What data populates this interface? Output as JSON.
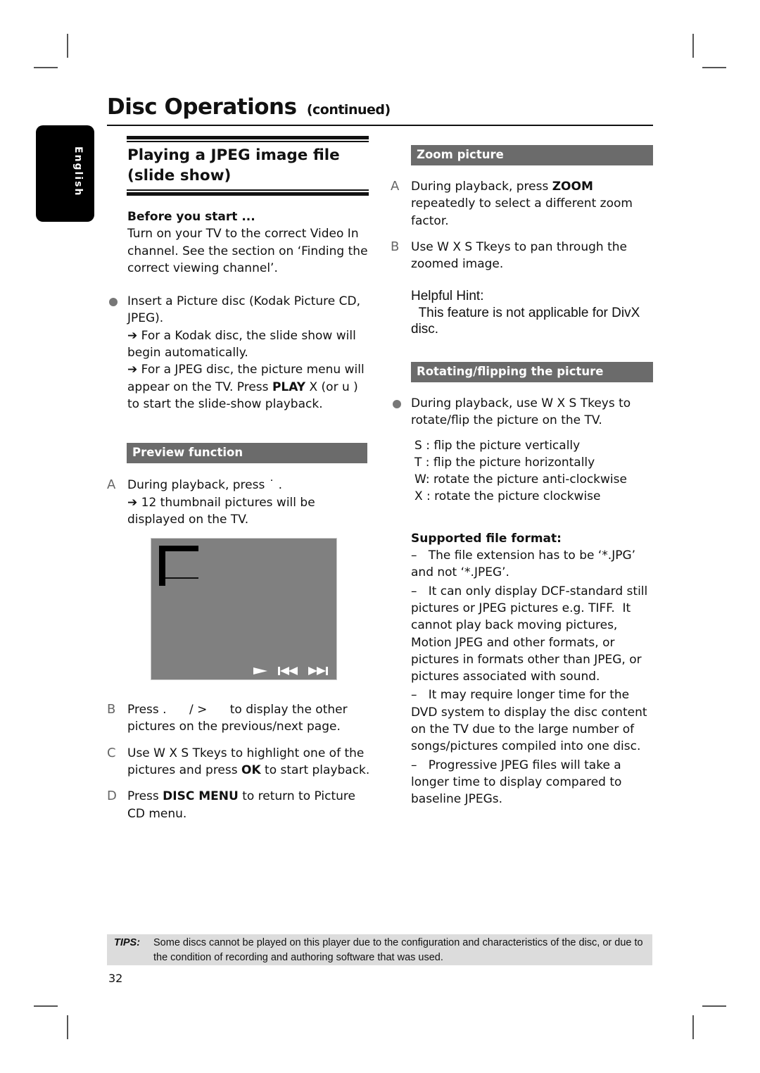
{
  "page": {
    "title": "Disc Operations",
    "title_suffix": "(continued)",
    "language_tab": "English",
    "page_number": "32"
  },
  "left_column": {
    "section_title_line1": "Playing a JPEG image file",
    "section_title_line2": "(slide show)",
    "before_start": {
      "heading": "Before you start ...",
      "text": "Turn on your TV to the correct Video In channel.  See the section on ‘Finding the correct viewing channel’."
    },
    "insert_step": {
      "text": "Insert a Picture disc (Kodak Picture CD, JPEG).",
      "result1": "➔ For a Kodak disc, the slide show will begin automatically.",
      "result2_pre": "➔ For a JPEG disc, the picture menu will appear on the TV.  Press ",
      "result2_bold": "PLAY",
      "result2_post": "  X (or u    ) to start the slide-show playback."
    },
    "preview": {
      "bar_label": "Preview function",
      "steps": [
        {
          "marker": "A",
          "text": "During playback, press ˙   .",
          "result": "➔ 12 thumbnail pictures will be displayed on the TV."
        },
        {
          "marker": "B",
          "text": "Press .      / >      to display the other pictures on the previous/next page."
        },
        {
          "marker": "C",
          "text_pre": "Use  W X S Tkeys to highlight one of the pictures and press ",
          "text_bold": "OK",
          "text_post": " to start playback."
        },
        {
          "marker": "D",
          "text_pre": "Press ",
          "text_bold": "DISC MENU",
          "text_post": " to return to Picture CD menu."
        }
      ],
      "tv_screen_icons": [
        "play-icon",
        "previous-icon",
        "next-icon"
      ]
    }
  },
  "right_column": {
    "zoom": {
      "bar_label": "Zoom picture",
      "steps": [
        {
          "marker": "A",
          "text_pre": "During playback, press ",
          "text_bold": "ZOOM",
          "text_post": " repeatedly to select a different zoom factor."
        },
        {
          "marker": "B",
          "text": "Use  W X S Tkeys to pan through the zoomed image."
        }
      ],
      "hint_title": "Helpful Hint:",
      "hint_text": "  This feature is not applicable for DivX disc."
    },
    "rotate": {
      "bar_label": "Rotating/flipping the picture",
      "bullet": "During playback, use  W X S Tkeys to rotate/flip the picture on the TV.",
      "keys": [
        "S : flip the picture vertically",
        "T : flip the picture horizontally",
        "W: rotate the picture anti-clockwise",
        "X : rotate the picture clockwise"
      ]
    },
    "supported": {
      "heading": "Supported file format:",
      "items": [
        "–   The file extension has to be ‘*.JPG’ and not ‘*.JPEG’.",
        "–   It can only display DCF-standard still pictures or JPEG pictures e.g. TIFF.  It cannot play back moving pictures, Motion JPEG and other formats, or pictures in formats other than JPEG, or pictures associated with sound.",
        "–   It may require longer time for the DVD system to display the disc content on the TV due to the large number of songs/pictures compiled into one disc.",
        "–   Progressive JPEG files will take a longer time to display compared to baseline JPEGs."
      ]
    }
  },
  "tips": {
    "label": "TIPS:",
    "text": "Some discs cannot be played on this player due to the configuration and characteristics of the disc, or due to the condition of recording and authoring software that was used."
  }
}
